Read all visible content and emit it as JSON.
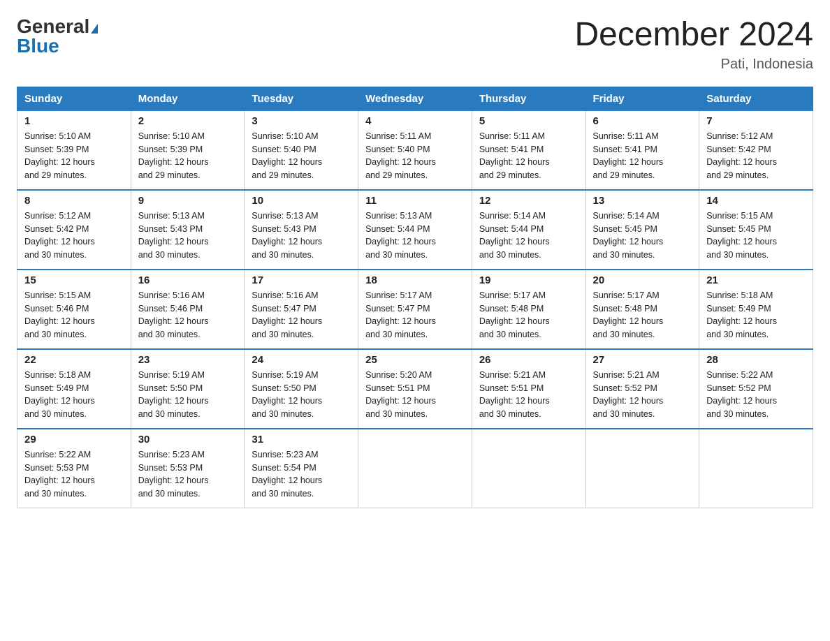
{
  "header": {
    "logo": {
      "general": "General",
      "blue": "Blue"
    },
    "title": "December 2024",
    "subtitle": "Pati, Indonesia"
  },
  "days_of_week": [
    "Sunday",
    "Monday",
    "Tuesday",
    "Wednesday",
    "Thursday",
    "Friday",
    "Saturday"
  ],
  "weeks": [
    [
      {
        "day": "1",
        "sunrise": "5:10 AM",
        "sunset": "5:39 PM",
        "daylight": "12 hours and 29 minutes."
      },
      {
        "day": "2",
        "sunrise": "5:10 AM",
        "sunset": "5:39 PM",
        "daylight": "12 hours and 29 minutes."
      },
      {
        "day": "3",
        "sunrise": "5:10 AM",
        "sunset": "5:40 PM",
        "daylight": "12 hours and 29 minutes."
      },
      {
        "day": "4",
        "sunrise": "5:11 AM",
        "sunset": "5:40 PM",
        "daylight": "12 hours and 29 minutes."
      },
      {
        "day": "5",
        "sunrise": "5:11 AM",
        "sunset": "5:41 PM",
        "daylight": "12 hours and 29 minutes."
      },
      {
        "day": "6",
        "sunrise": "5:11 AM",
        "sunset": "5:41 PM",
        "daylight": "12 hours and 29 minutes."
      },
      {
        "day": "7",
        "sunrise": "5:12 AM",
        "sunset": "5:42 PM",
        "daylight": "12 hours and 29 minutes."
      }
    ],
    [
      {
        "day": "8",
        "sunrise": "5:12 AM",
        "sunset": "5:42 PM",
        "daylight": "12 hours and 30 minutes."
      },
      {
        "day": "9",
        "sunrise": "5:13 AM",
        "sunset": "5:43 PM",
        "daylight": "12 hours and 30 minutes."
      },
      {
        "day": "10",
        "sunrise": "5:13 AM",
        "sunset": "5:43 PM",
        "daylight": "12 hours and 30 minutes."
      },
      {
        "day": "11",
        "sunrise": "5:13 AM",
        "sunset": "5:44 PM",
        "daylight": "12 hours and 30 minutes."
      },
      {
        "day": "12",
        "sunrise": "5:14 AM",
        "sunset": "5:44 PM",
        "daylight": "12 hours and 30 minutes."
      },
      {
        "day": "13",
        "sunrise": "5:14 AM",
        "sunset": "5:45 PM",
        "daylight": "12 hours and 30 minutes."
      },
      {
        "day": "14",
        "sunrise": "5:15 AM",
        "sunset": "5:45 PM",
        "daylight": "12 hours and 30 minutes."
      }
    ],
    [
      {
        "day": "15",
        "sunrise": "5:15 AM",
        "sunset": "5:46 PM",
        "daylight": "12 hours and 30 minutes."
      },
      {
        "day": "16",
        "sunrise": "5:16 AM",
        "sunset": "5:46 PM",
        "daylight": "12 hours and 30 minutes."
      },
      {
        "day": "17",
        "sunrise": "5:16 AM",
        "sunset": "5:47 PM",
        "daylight": "12 hours and 30 minutes."
      },
      {
        "day": "18",
        "sunrise": "5:17 AM",
        "sunset": "5:47 PM",
        "daylight": "12 hours and 30 minutes."
      },
      {
        "day": "19",
        "sunrise": "5:17 AM",
        "sunset": "5:48 PM",
        "daylight": "12 hours and 30 minutes."
      },
      {
        "day": "20",
        "sunrise": "5:17 AM",
        "sunset": "5:48 PM",
        "daylight": "12 hours and 30 minutes."
      },
      {
        "day": "21",
        "sunrise": "5:18 AM",
        "sunset": "5:49 PM",
        "daylight": "12 hours and 30 minutes."
      }
    ],
    [
      {
        "day": "22",
        "sunrise": "5:18 AM",
        "sunset": "5:49 PM",
        "daylight": "12 hours and 30 minutes."
      },
      {
        "day": "23",
        "sunrise": "5:19 AM",
        "sunset": "5:50 PM",
        "daylight": "12 hours and 30 minutes."
      },
      {
        "day": "24",
        "sunrise": "5:19 AM",
        "sunset": "5:50 PM",
        "daylight": "12 hours and 30 minutes."
      },
      {
        "day": "25",
        "sunrise": "5:20 AM",
        "sunset": "5:51 PM",
        "daylight": "12 hours and 30 minutes."
      },
      {
        "day": "26",
        "sunrise": "5:21 AM",
        "sunset": "5:51 PM",
        "daylight": "12 hours and 30 minutes."
      },
      {
        "day": "27",
        "sunrise": "5:21 AM",
        "sunset": "5:52 PM",
        "daylight": "12 hours and 30 minutes."
      },
      {
        "day": "28",
        "sunrise": "5:22 AM",
        "sunset": "5:52 PM",
        "daylight": "12 hours and 30 minutes."
      }
    ],
    [
      {
        "day": "29",
        "sunrise": "5:22 AM",
        "sunset": "5:53 PM",
        "daylight": "12 hours and 30 minutes."
      },
      {
        "day": "30",
        "sunrise": "5:23 AM",
        "sunset": "5:53 PM",
        "daylight": "12 hours and 30 minutes."
      },
      {
        "day": "31",
        "sunrise": "5:23 AM",
        "sunset": "5:54 PM",
        "daylight": "12 hours and 30 minutes."
      },
      null,
      null,
      null,
      null
    ]
  ]
}
